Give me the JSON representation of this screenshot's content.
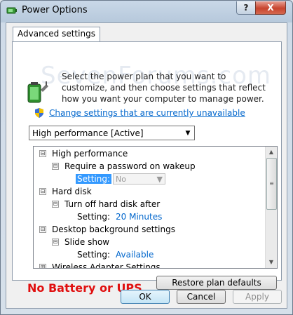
{
  "window": {
    "title": "Power Options",
    "help_label": "?",
    "close_label": "X"
  },
  "tab": {
    "label": "Advanced settings"
  },
  "watermark": "SevenForums.com",
  "description": "Select the power plan that you want to customize, and then choose settings that reflect how you want your computer to manage power.",
  "change_link": "Change settings that are currently unavailable",
  "plan_select": {
    "value": "High performance [Active]"
  },
  "tree": {
    "items": [
      {
        "label": "High performance",
        "expander": "⊟"
      },
      {
        "label": "Require a password on wakeup",
        "expander": "⊟"
      },
      {
        "setting_label": "Setting:",
        "value": "No"
      },
      {
        "label": "Hard disk",
        "expander": "⊟"
      },
      {
        "label": "Turn off hard disk after",
        "expander": "⊟"
      },
      {
        "setting_label": "Setting:",
        "value": "20 Minutes"
      },
      {
        "label": "Desktop background settings",
        "expander": "⊟"
      },
      {
        "label": "Slide show",
        "expander": "⊟"
      },
      {
        "setting_label": "Setting:",
        "value": "Available"
      },
      {
        "label": "Wireless Adapter Settings",
        "expander": "⊞"
      }
    ]
  },
  "note": "No Battery or UPS",
  "buttons": {
    "restore": "Restore plan defaults",
    "ok": "OK",
    "cancel": "Cancel",
    "apply": "Apply"
  },
  "colors": {
    "link": "#0066cc",
    "note": "#e01010",
    "selection": "#3399ff"
  }
}
